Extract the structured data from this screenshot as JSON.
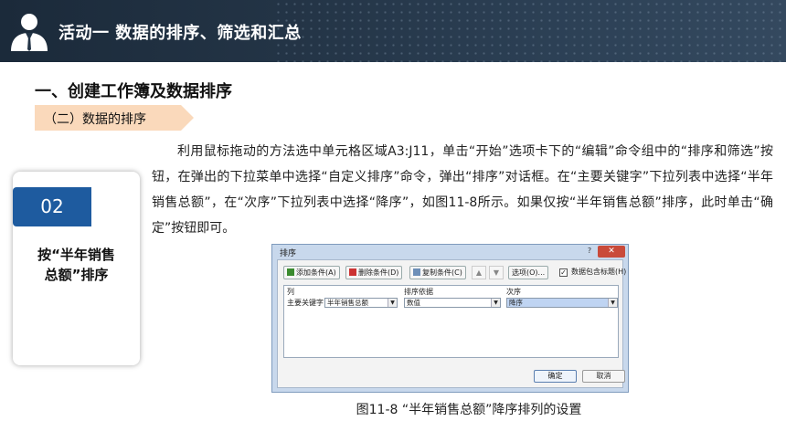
{
  "header": {
    "title": "活动一  数据的排序、筛选和汇总"
  },
  "section": {
    "title": "一、创建工作簿及数据排序",
    "subtitle_tag": "（二）数据的排序"
  },
  "card": {
    "number": "02",
    "title": "按“半年销售总额”排序"
  },
  "paragraph": "利用鼠标拖动的方法选中单元格区域A3:J11，单击“开始”选项卡下的“编辑”命令组中的“排序和筛选”按钮，在弹出的下拉菜单中选择“自定义排序”命令，弹出“排序”对话框。在“主要关键字”下拉列表中选择“半年销售总额”，在“次序”下拉列表中选择“降序”，如图11-8所示。如果仅按“半年销售总额”排序，此时单击“确定”按钮即可。",
  "dialog": {
    "title": "排序",
    "help": "?",
    "close": "✕",
    "toolbar": {
      "add": "添加条件(A)",
      "delete": "删除条件(D)",
      "copy": "复制条件(C)",
      "up": "▲",
      "down": "▼",
      "options": "选项(O)...",
      "checkbox_checked": "✓",
      "checkbox_label": "数据包含标题(H)"
    },
    "columns": {
      "col": "列",
      "basis": "排序依据",
      "order": "次序"
    },
    "row": {
      "label": "主要关键字",
      "column_value": "半年销售总额",
      "basis_value": "数值",
      "order_value": "降序"
    },
    "ok": "确定",
    "cancel": "取消"
  },
  "caption": "图11-8  “半年销售总额”降序排列的设置",
  "colors": {
    "header_bg": "#243547",
    "tag_bg": "#fad9bb",
    "badge_bg": "#1e5b9f"
  }
}
